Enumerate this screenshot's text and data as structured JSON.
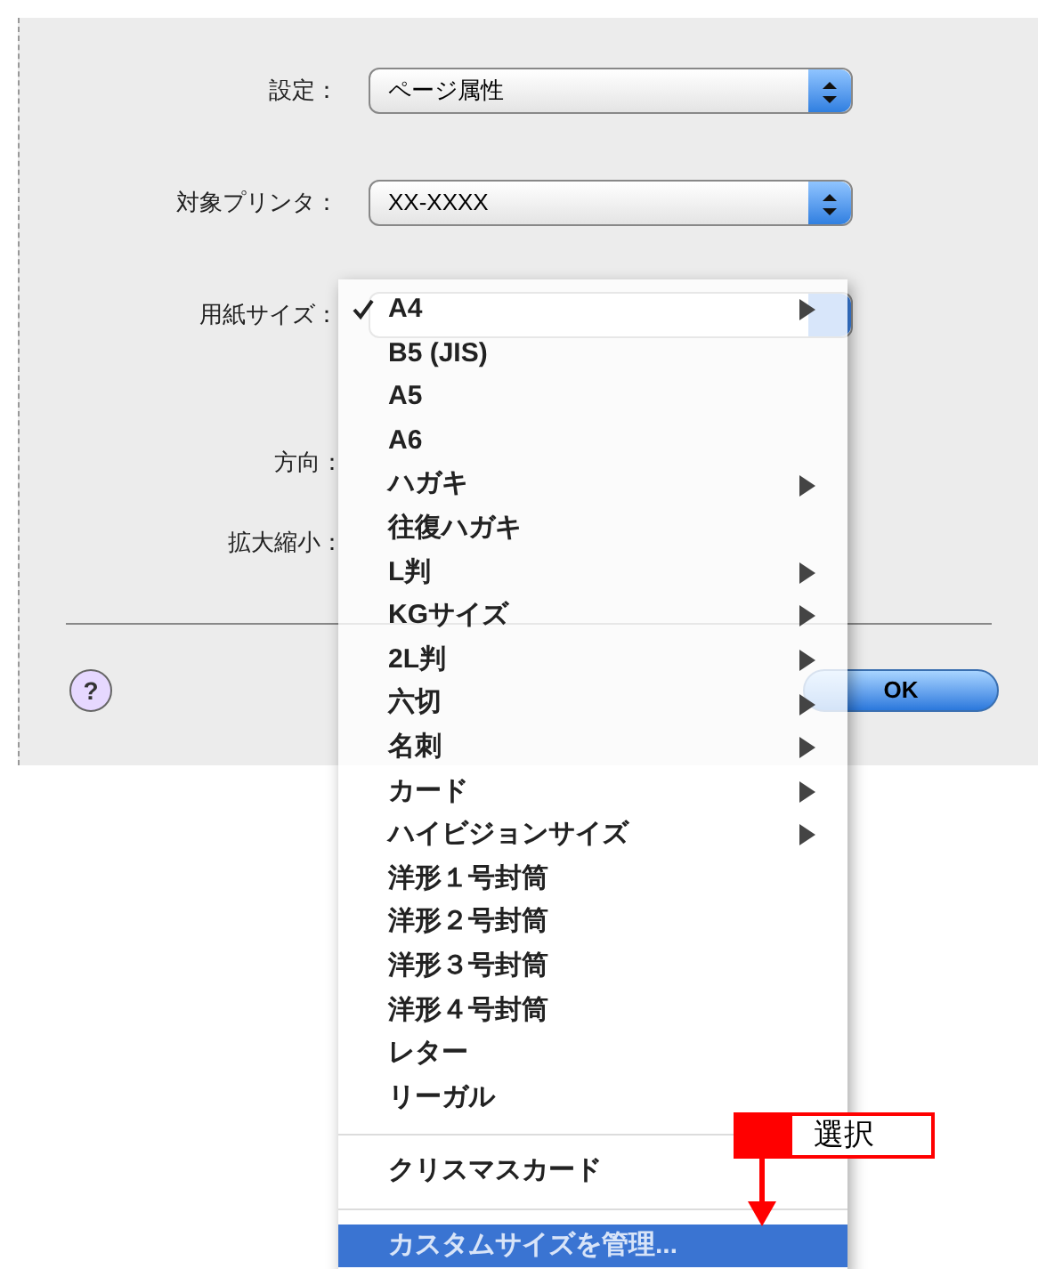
{
  "dialog": {
    "fields": [
      {
        "label": "設定：",
        "value": "ページ属性"
      },
      {
        "label": "対象プリンタ：",
        "value": "XX-XXXX"
      },
      {
        "label": "用紙サイズ："
      }
    ],
    "help_label": "?",
    "orientation_label": "方向：",
    "scale_label": "拡大縮小：",
    "buttons": [
      {
        "label": "OK",
        "kind": "default"
      }
    ]
  },
  "paper_menu": {
    "items": [
      {
        "kind": "item",
        "label": "A4",
        "checked": true,
        "submenu": true,
        "selected": false
      },
      {
        "kind": "item",
        "label": "B5 (JIS)",
        "checked": false,
        "submenu": false,
        "selected": false
      },
      {
        "kind": "item",
        "label": "A5",
        "checked": false,
        "submenu": false,
        "selected": false
      },
      {
        "kind": "item",
        "label": "A6",
        "checked": false,
        "submenu": false,
        "selected": false
      },
      {
        "kind": "item",
        "label": "ハガキ",
        "checked": false,
        "submenu": true,
        "selected": false
      },
      {
        "kind": "item",
        "label": "往復ハガキ",
        "checked": false,
        "submenu": false,
        "selected": false
      },
      {
        "kind": "item",
        "label": "L判",
        "checked": false,
        "submenu": true,
        "selected": false
      },
      {
        "kind": "item",
        "label": "KGサイズ",
        "checked": false,
        "submenu": true,
        "selected": false
      },
      {
        "kind": "item",
        "label": "2L判",
        "checked": false,
        "submenu": true,
        "selected": false
      },
      {
        "kind": "item",
        "label": "六切",
        "checked": false,
        "submenu": true,
        "selected": false
      },
      {
        "kind": "item",
        "label": "名刺",
        "checked": false,
        "submenu": true,
        "selected": false
      },
      {
        "kind": "item",
        "label": "カード",
        "checked": false,
        "submenu": true,
        "selected": false
      },
      {
        "kind": "item",
        "label": "ハイビジョンサイズ",
        "checked": false,
        "submenu": true,
        "selected": false
      },
      {
        "kind": "item",
        "label": "洋形１号封筒",
        "checked": false,
        "submenu": false,
        "selected": false
      },
      {
        "kind": "item",
        "label": "洋形２号封筒",
        "checked": false,
        "submenu": false,
        "selected": false
      },
      {
        "kind": "item",
        "label": "洋形３号封筒",
        "checked": false,
        "submenu": false,
        "selected": false
      },
      {
        "kind": "item",
        "label": "洋形４号封筒",
        "checked": false,
        "submenu": false,
        "selected": false
      },
      {
        "kind": "item",
        "label": "レター",
        "checked": false,
        "submenu": false,
        "selected": false
      },
      {
        "kind": "item",
        "label": "リーガル",
        "checked": false,
        "submenu": false,
        "selected": false
      },
      {
        "kind": "separator"
      },
      {
        "kind": "item",
        "label": "クリスマスカード",
        "checked": false,
        "submenu": false,
        "selected": false
      },
      {
        "kind": "separator"
      },
      {
        "kind": "item",
        "label": "カスタムサイズを管理...",
        "checked": false,
        "submenu": false,
        "selected": true
      }
    ]
  },
  "callout": {
    "label": "選択"
  }
}
